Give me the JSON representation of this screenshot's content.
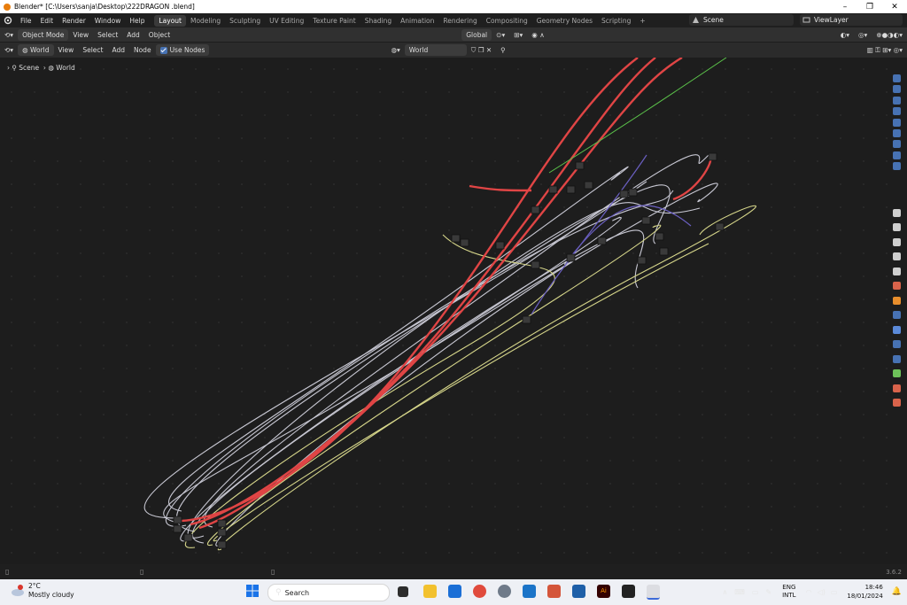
{
  "window": {
    "title": "Blender* [C:\\Users\\sanja\\Desktop\\222DRAGON .blend]",
    "controls": {
      "minimize": "–",
      "maximize": "❐",
      "close": "✕"
    }
  },
  "topbar": {
    "menu": [
      "File",
      "Edit",
      "Render",
      "Window",
      "Help"
    ],
    "workspaces": [
      "Layout",
      "Modeling",
      "Sculpting",
      "UV Editing",
      "Texture Paint",
      "Shading",
      "Animation",
      "Rendering",
      "Compositing",
      "Geometry Nodes",
      "Scripting"
    ],
    "active_workspace": "Layout",
    "add_tab": "+",
    "scene": "Scene",
    "view_layer": "ViewLayer"
  },
  "header1": {
    "mode": "Object Mode",
    "menu": [
      "View",
      "Select",
      "Add",
      "Object"
    ],
    "orientation": "Global"
  },
  "header2": {
    "shader_type": "World",
    "menu": [
      "View",
      "Select",
      "Add",
      "Node"
    ],
    "use_nodes_label": "Use Nodes",
    "use_nodes_checked": true,
    "world_name": "World"
  },
  "breadcrumb": {
    "items": [
      "Scene",
      "World"
    ]
  },
  "status": {
    "version": "3.6.2"
  },
  "taskbar": {
    "weather_temp": "2°C",
    "weather_desc": "Mostly cloudy",
    "weather_badge": "1",
    "search_placeholder": "Search",
    "lang_line1": "ENG",
    "lang_line2": "INTL",
    "time": "18:46",
    "date": "18/01/2024"
  },
  "colors": {
    "accent_blue": "#4772b3",
    "link_red": "#e04545",
    "link_grey": "#c7c7d2",
    "link_yellow": "#d6d68a",
    "link_green": "#5bc24a",
    "link_purple": "#6a5fc1"
  }
}
